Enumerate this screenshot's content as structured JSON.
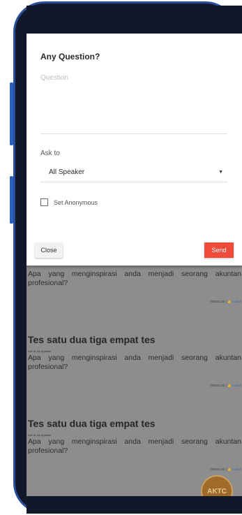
{
  "dialog": {
    "title": "Any Question?",
    "question_placeholder": "Question",
    "ask_to_label": "Ask to",
    "ask_to_value": "All Speaker",
    "anonymous_label": "Set Anonymous",
    "anonymous_checked": false,
    "close_label": "Close",
    "send_label": "Send",
    "send_color": "#f04a3a"
  },
  "feed": {
    "items": [
      {
        "title": "",
        "ask_to": "",
        "body": "Apa yang menginspirasi anda menjadi seorang akuntan profesional?",
        "time": "06:51:20",
        "likes": "1 Likes"
      },
      {
        "title": "Tes satu dua tiga empat tes",
        "ask_to": "Ask to: All Speaker",
        "body": "Apa yang menginspirasi anda menjadi seorang akuntan profesional?",
        "time": "06:51:42",
        "likes": "1 Likes"
      },
      {
        "title": "Tes satu dua tiga empat tes",
        "ask_to": "Ask to: All Speaker",
        "body": "Apa yang menginspirasi anda menjadi seorang akuntan profesional?",
        "time": "06:51:43",
        "likes": "1 Likes"
      }
    ]
  },
  "fab": {
    "label": "AKTC"
  }
}
